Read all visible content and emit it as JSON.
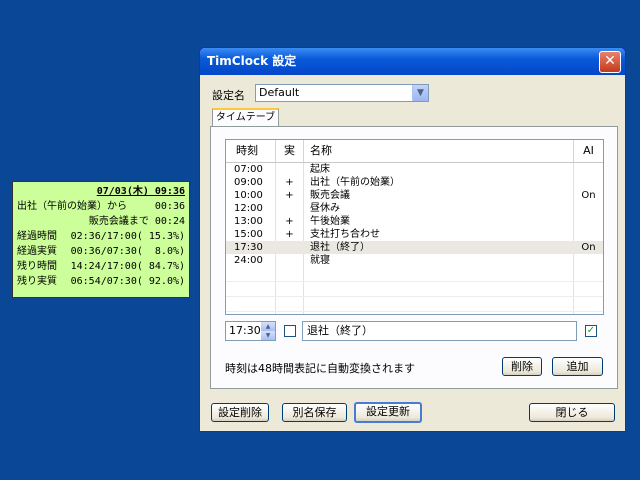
{
  "widget": {
    "date_time": "07/03(木) 09:36",
    "lines": [
      {
        "label": "出社（午前の始業）から",
        "value": "00:36"
      },
      {
        "label": "販売会議まで",
        "value": "00:24"
      },
      {
        "label": "経過時間",
        "value": "02:36/17:00( 15.3%)"
      },
      {
        "label": "経過実質",
        "value": "00:36/07:30(  8.0%)"
      },
      {
        "label": "残り時間",
        "value": "14:24/17:00( 84.7%)"
      },
      {
        "label": "残り実質",
        "value": "06:54/07:30( 92.0%)"
      }
    ]
  },
  "dialog": {
    "title": "TimClock 設定",
    "close_glyph": "✕",
    "config_label": "設定名",
    "config_value": "Default",
    "tab_label": "タイムテーブル",
    "columns": {
      "time": "時刻",
      "real": "実",
      "name": "名称",
      "ai": "AI"
    },
    "rows": [
      {
        "time": "07:00",
        "real": "",
        "name": "起床",
        "ai": ""
      },
      {
        "time": "09:00",
        "real": "+",
        "name": "出社（午前の始業）",
        "ai": ""
      },
      {
        "time": "10:00",
        "real": "+",
        "name": "販売会議",
        "ai": "On"
      },
      {
        "time": "12:00",
        "real": "",
        "name": "昼休み",
        "ai": ""
      },
      {
        "time": "13:00",
        "real": "+",
        "name": "午後始業",
        "ai": ""
      },
      {
        "time": "15:00",
        "real": "+",
        "name": "支社打ち合わせ",
        "ai": ""
      },
      {
        "time": "17:30",
        "real": "",
        "name": "退社（終了）",
        "ai": "On",
        "selected": true
      },
      {
        "time": "24:00",
        "real": "",
        "name": "就寝",
        "ai": ""
      }
    ],
    "edit": {
      "time": "17:30",
      "real_checked": false,
      "name": "退社（終了）",
      "ai_checked": true,
      "check_glyph": "✓"
    },
    "note": "時刻は48時間表記に自動変換されます",
    "buttons": {
      "delete": "削除",
      "add": "追加",
      "delete_config": "設定削除",
      "save_as": "別名保存",
      "update": "設定更新",
      "close": "閉じる"
    },
    "icons": {
      "dropdown": "chevron-down-icon",
      "spin_up": "▲",
      "spin_down": "▼",
      "combo_arrow": "▼"
    }
  },
  "colors": {
    "desktop": "#0a4797",
    "widget_bg": "#ccff99",
    "dialog_bg": "#ece9d8",
    "title_blue": "#0a5ad9",
    "selection": "#eae8e1"
  }
}
